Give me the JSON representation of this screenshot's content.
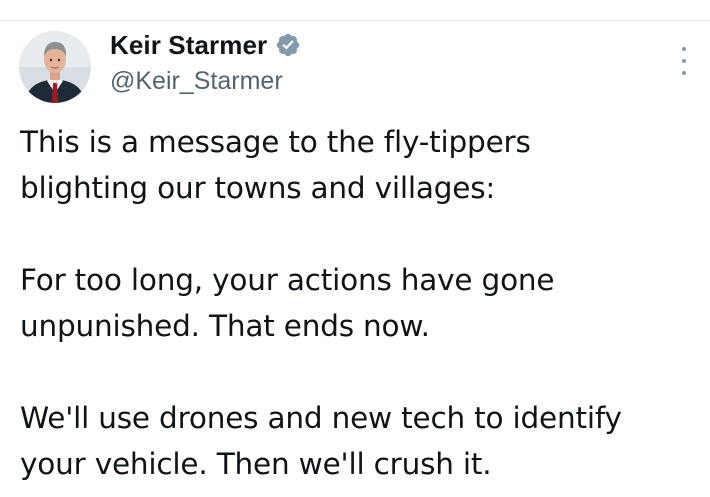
{
  "tweet": {
    "author": {
      "display_name": "Keir Starmer",
      "handle": "@Keir_Starmer",
      "verified": true,
      "verified_color": "#829aab"
    },
    "paragraphs": [
      "This is a message to the fly-tippers\nblighting our towns and villages:",
      "For too long, your actions have gone\nunpunished. That ends now.",
      "We'll use drones and new tech to identify\nyour vehicle. Then we'll crush it."
    ],
    "icons": {
      "avatar": "profile-photo",
      "verified": "verified-badge-icon",
      "more": "more-options-icon"
    }
  }
}
